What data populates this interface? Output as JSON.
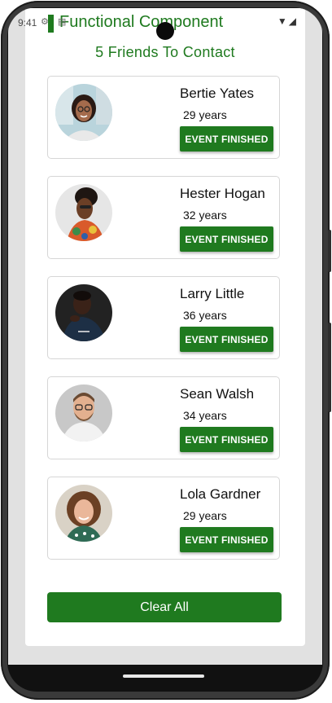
{
  "status_bar": {
    "time": "9:41",
    "left_icons": "⚙ ▤",
    "right_icons": "▼◢"
  },
  "app": {
    "title": "Functional Component",
    "list_heading": "5 Friends To Contact"
  },
  "friends": [
    {
      "name": "Bertie Yates",
      "age": "29 years",
      "button": "EVENT FINISHED",
      "avatar": "woman-glasses-avatar"
    },
    {
      "name": "Hester Hogan",
      "age": "32 years",
      "button": "EVENT FINISHED",
      "avatar": "woman-headwrap-avatar"
    },
    {
      "name": "Larry Little",
      "age": "36 years",
      "button": "EVENT FINISHED",
      "avatar": "man-dark-shirt-avatar"
    },
    {
      "name": "Sean Walsh",
      "age": "34 years",
      "button": "EVENT FINISHED",
      "avatar": "man-beard-glasses-avatar"
    },
    {
      "name": "Lola Gardner",
      "age": "29 years",
      "button": "EVENT FINISHED",
      "avatar": "woman-curly-hair-avatar"
    }
  ],
  "clear_button": "Clear All",
  "colors": {
    "accent": "#1f7a1f",
    "screen_bg": "#e1e1e1",
    "card_border": "#d6d6d6"
  }
}
